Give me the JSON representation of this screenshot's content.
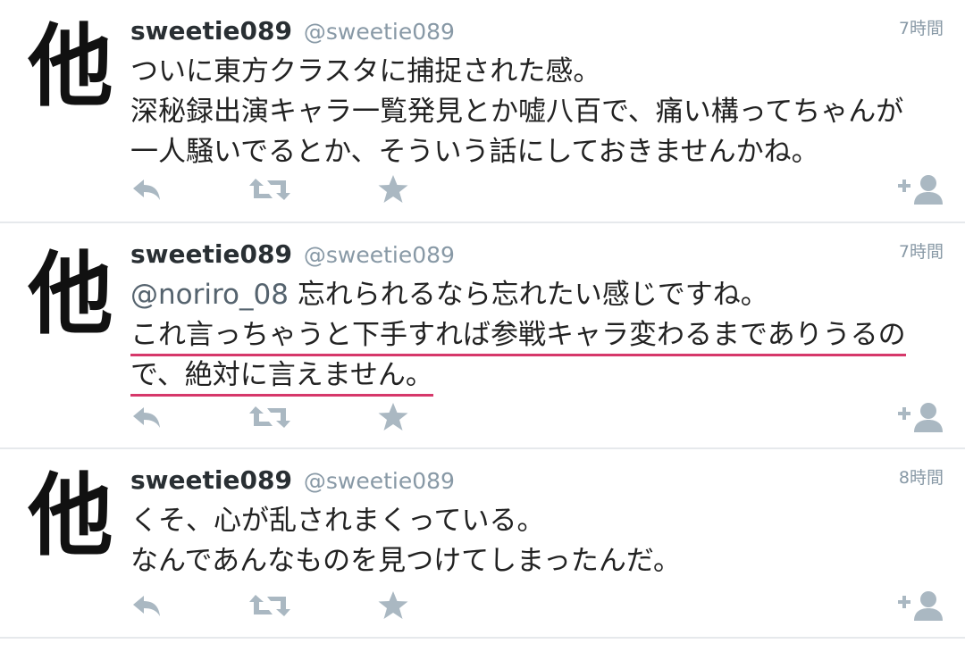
{
  "colors": {
    "icon_gray": "#aab8c2",
    "handle_gray": "#8899a6",
    "underline": "#d6386a",
    "divider": "#e6e9ec"
  },
  "icons": [
    "reply-icon",
    "retweet-icon",
    "favorite-star-icon",
    "follow-user-icon"
  ],
  "tweets": [
    {
      "avatar_text": "他",
      "name": "sweetie089",
      "handle": "@sweetie089",
      "time": "7時間",
      "lines": [
        "ついに東方クラスタに捕捉された感。",
        "深秘録出演キャラ一覧発見とか嘘八百で、痛い構ってちゃんが",
        "一人騒いでるとか、そういう話にしておきませんかね。"
      ]
    },
    {
      "avatar_text": "他",
      "name": "sweetie089",
      "handle": "@sweetie089",
      "time": "7時間",
      "mention": "@noriro_08",
      "lines": [
        "忘れられるなら忘れたい感じですね。",
        "これ言っちゃうと下手すれば参戦キャラ変わるまでありうるの",
        "で、絶対に言えません。"
      ]
    },
    {
      "avatar_text": "他",
      "name": "sweetie089",
      "handle": "@sweetie089",
      "time": "8時間",
      "lines": [
        "くそ、心が乱されまくっている。",
        "なんであんなものを見つけてしまったんだ。"
      ]
    }
  ]
}
